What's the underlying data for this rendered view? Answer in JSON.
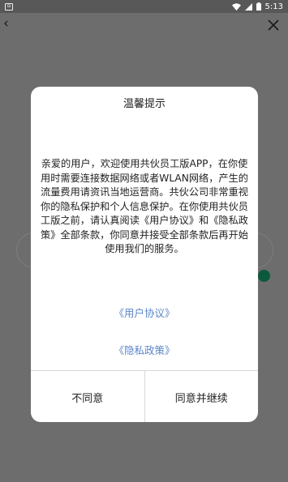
{
  "status_bar": {
    "time": "5:13",
    "left_icon": "notification-icon",
    "right_icons": [
      "wifi-icon",
      "signal-icon",
      "battery-icon"
    ]
  },
  "top_bar": {
    "back_icon": "back-chevron-icon",
    "close_icon": "close-icon"
  },
  "dialog": {
    "title": "温馨提示",
    "body": "亲爱的用户，欢迎使用共伙员工版APP，在你使用时需要连接数据网络或者WLAN网络，产生的流量费用请资讯当地运营商。共伙公司非常重视你的隐私保护和个人信息保护。在你使用共伙员工版之前，请认真阅读《用户协议》和《隐私政策》全部条款，你同意并接受全部条款后再开始使用我们的服务。",
    "link_agreement": "《用户协议》",
    "link_privacy": "《隐私政策》",
    "disagree_label": "不同意",
    "agree_label": "同意并继续"
  },
  "colors": {
    "overlay_bg": "#6d6d6d",
    "status_bar_bg": "#585858",
    "link": "#5b86c9",
    "dialog_bg": "#ffffff",
    "radio_accent": "#0b5a3e"
  }
}
